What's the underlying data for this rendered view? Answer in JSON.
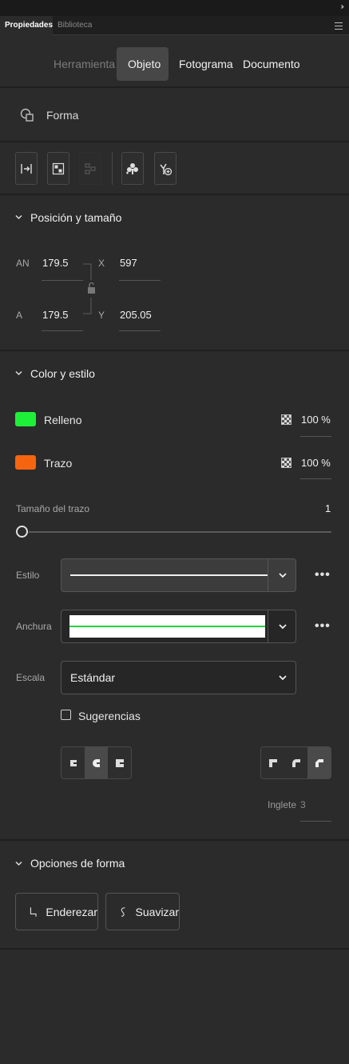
{
  "panel": {
    "tabs": [
      "Propiedades",
      "Biblioteca"
    ],
    "collapse_glyph": "››"
  },
  "context_tabs": [
    "Herramienta",
    "Objeto",
    "Fotograma",
    "Documento"
  ],
  "object": {
    "type_label": "Forma"
  },
  "position_size": {
    "title": "Posición y tamaño",
    "w_label": "AN",
    "w_value": "179.5",
    "h_label": "A",
    "h_value": "179.5",
    "x_label": "X",
    "x_value": "597",
    "y_label": "Y",
    "y_value": "205.05"
  },
  "color_style": {
    "title": "Color y estilo",
    "fill_label": "Relleno",
    "fill_color": "#1ef03a",
    "fill_alpha": "100 %",
    "stroke_label": "Trazo",
    "stroke_color": "#f5650f",
    "stroke_alpha": "100 %",
    "stroke_size_label": "Tamaño del trazo",
    "stroke_size_value": "1",
    "style_label": "Estilo",
    "width_label": "Anchura",
    "scale_label": "Escala",
    "scale_value": "Estándar",
    "hints_label": "Sugerencias",
    "more_glyph": "•••",
    "miter_label": "Inglete",
    "miter_value": "3"
  },
  "shape_options": {
    "title": "Opciones de forma",
    "straighten_label": "Enderezar",
    "smooth_label": "Suavizar"
  }
}
